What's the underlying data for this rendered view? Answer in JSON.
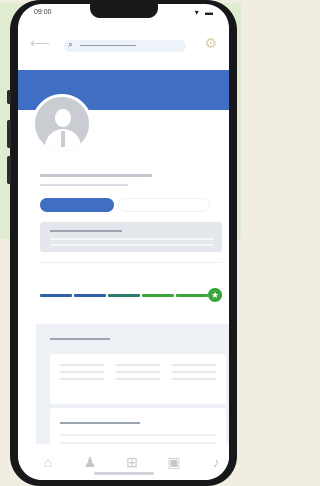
{
  "status_bar": {
    "time": "09:00",
    "icons": "▾ ▬"
  },
  "top_bar": {
    "back_glyph": "⟵",
    "search_glyph": "⌕",
    "settings_glyph": "⚙"
  },
  "progress": {
    "segments": 5,
    "completed_fraction": 1.0,
    "star_glyph": "★"
  },
  "tabs": [
    {
      "name": "home",
      "glyph": "⌂"
    },
    {
      "name": "people",
      "glyph": "♟"
    },
    {
      "name": "add",
      "glyph": "⊞"
    },
    {
      "name": "briefcase",
      "glyph": "▣"
    },
    {
      "name": "bell",
      "glyph": "♪"
    }
  ],
  "colors": {
    "primary": "#3f6ec2",
    "accent_green": "#3aa53a",
    "progress_blue": "#2f5fa8",
    "progress_teal": "#2c7a6e",
    "progress_green": "#3aa53a"
  }
}
